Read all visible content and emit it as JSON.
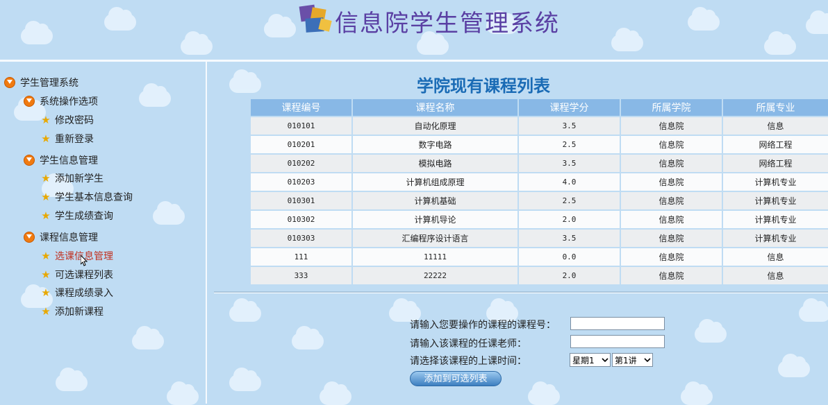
{
  "header": {
    "title": "信息院学生管理系统"
  },
  "sidebar": {
    "root": "学生管理系统",
    "groups": [
      {
        "label": "系统操作选项",
        "items": [
          "修改密码",
          "重新登录"
        ]
      },
      {
        "label": "学生信息管理",
        "items": [
          "添加新学生",
          "学生基本信息查询",
          "学生成绩查询"
        ]
      },
      {
        "label": "课程信息管理",
        "items": [
          "选课信息管理",
          "可选课程列表",
          "课程成绩录入",
          "添加新课程"
        ]
      }
    ],
    "active_item": "选课信息管理"
  },
  "main": {
    "title": "学院现有课程列表",
    "table": {
      "headers": [
        "课程编号",
        "课程名称",
        "课程学分",
        "所属学院",
        "所属专业"
      ],
      "rows": [
        [
          "010101",
          "自动化原理",
          "3.5",
          "信息院",
          "信息"
        ],
        [
          "010201",
          "数字电路",
          "2.5",
          "信息院",
          "网络工程"
        ],
        [
          "010202",
          "模拟电路",
          "3.5",
          "信息院",
          "网络工程"
        ],
        [
          "010203",
          "计算机组成原理",
          "4.0",
          "信息院",
          "计算机专业"
        ],
        [
          "010301",
          "计算机基础",
          "2.5",
          "信息院",
          "计算机专业"
        ],
        [
          "010302",
          "计算机导论",
          "2.0",
          "信息院",
          "计算机专业"
        ],
        [
          "010303",
          "汇编程序设计语言",
          "3.5",
          "信息院",
          "计算机专业"
        ],
        [
          "111",
          "11111",
          "0.0",
          "信息院",
          "信息"
        ],
        [
          "333",
          "22222",
          "2.0",
          "信息院",
          "信息"
        ]
      ]
    },
    "form": {
      "course_id_label": "请输入您要操作的课程的课程号：",
      "course_id_value": "",
      "teacher_label": "请输入该课程的任课老师：",
      "teacher_value": "",
      "time_label": "请选择该课程的上课时间：",
      "weekday_selected": "星期1",
      "period_selected": "第1讲",
      "submit_label": "添加到可选列表"
    }
  },
  "colors": {
    "background": "#bfdcf3",
    "header_title": "#5a3fa3",
    "table_header": "#88b8e6",
    "main_title": "#1a6bb5",
    "active_link": "#c03020"
  },
  "icons": {
    "group": "orange-circle-arrow-icon",
    "leaf": "star-icon"
  }
}
